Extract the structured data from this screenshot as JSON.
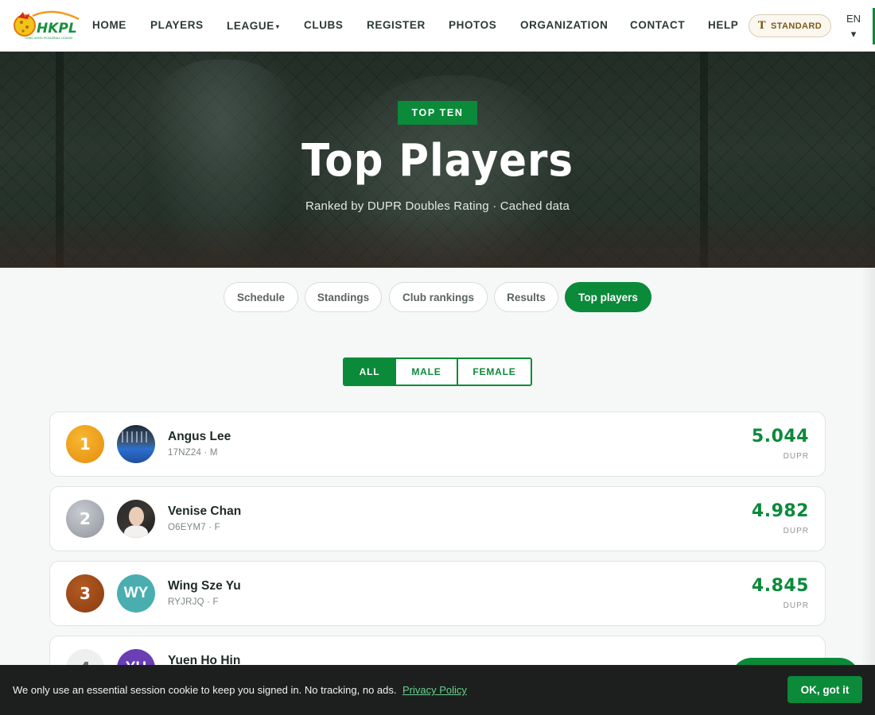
{
  "nav": {
    "logo_text": "HKPL",
    "logo_tagline": "HONG KONG PICKLEBALL LEAGUE",
    "items": [
      {
        "label": "HOME"
      },
      {
        "label": "PLAYERS"
      },
      {
        "label": "LEAGUE"
      },
      {
        "label": "CLUBS"
      },
      {
        "label": "REGISTER"
      },
      {
        "label": "PHOTOS"
      },
      {
        "label": "ORGANIZATION"
      },
      {
        "label": "CONTACT"
      },
      {
        "label": "HELP"
      }
    ],
    "dropdown_caret": "▾",
    "text_size_label": "STANDARD",
    "language": "EN",
    "language_caret": "▾"
  },
  "hero": {
    "eyebrow": "TOP TEN",
    "title": "Top Players",
    "subtitle": "Ranked by DUPR Doubles Rating · Cached data"
  },
  "tabs": [
    {
      "label": "Schedule",
      "active": false
    },
    {
      "label": "Standings",
      "active": false
    },
    {
      "label": "Club rankings",
      "active": false
    },
    {
      "label": "Results",
      "active": false
    },
    {
      "label": "Top players",
      "active": true
    }
  ],
  "gender_filter": {
    "options": [
      "ALL",
      "MALE",
      "FEMALE"
    ],
    "selected": "ALL"
  },
  "players": [
    {
      "rank": "1",
      "name": "Angus Lee",
      "meta": "17NZ24 · M",
      "rating": "5.044",
      "rating_label": "DUPR",
      "avatar": "photo"
    },
    {
      "rank": "2",
      "name": "Venise Chan",
      "meta": "O6EYM7 · F",
      "rating": "4.982",
      "rating_label": "DUPR",
      "avatar": "photo"
    },
    {
      "rank": "3",
      "name": "Wing Sze Yu",
      "meta": "RYJRJQ · F",
      "rating": "4.845",
      "rating_label": "DUPR",
      "avatar_initials": "WY"
    },
    {
      "rank": "4",
      "name": "Yuen Ho Hin",
      "meta": "",
      "rating": "",
      "rating_label": "",
      "avatar_initials": "YH"
    }
  ],
  "cookie": {
    "text": "We only use an essential session cookie to keep you signed in. No tracking, no ads.",
    "link": "Privacy Policy",
    "button": "OK, got it"
  },
  "colors": {
    "brand_green": "#0b8a3a",
    "gold": "#f0a01e",
    "silver": "#a9adb4",
    "bronze": "#9b4a1a"
  },
  "icons": {
    "text_size": "text-size-icon",
    "settings": "gear-icon"
  }
}
